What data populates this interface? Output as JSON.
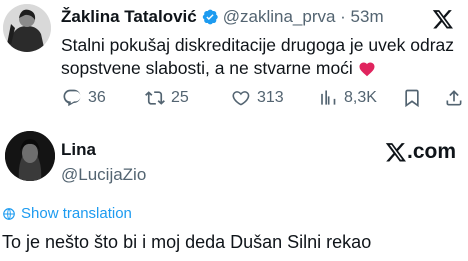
{
  "tweet": {
    "author_name": "Žaklina Tatalović",
    "handle_time": "@zaklina_prva · 53m",
    "text": "Stalni pokušaj diskreditacije drugoga je uvek odraz sopstvene slabosti, a ne stvarne moći",
    "replies": "36",
    "retweets": "25",
    "likes": "313",
    "views": "8,3K",
    "brand_icon": "x-logo-icon"
  },
  "post": {
    "author_name": "Lina",
    "handle": "@LucijaZio",
    "brand": ".com",
    "translation_link": "Show translation",
    "text": "To je nešto što bi i moj deda Dušan Silni rekao"
  },
  "colors": {
    "text": "#0f1419",
    "secondary": "#536471",
    "link": "#1d9bf0",
    "verified": "#1d9bf0",
    "heart": "#e0245e"
  }
}
